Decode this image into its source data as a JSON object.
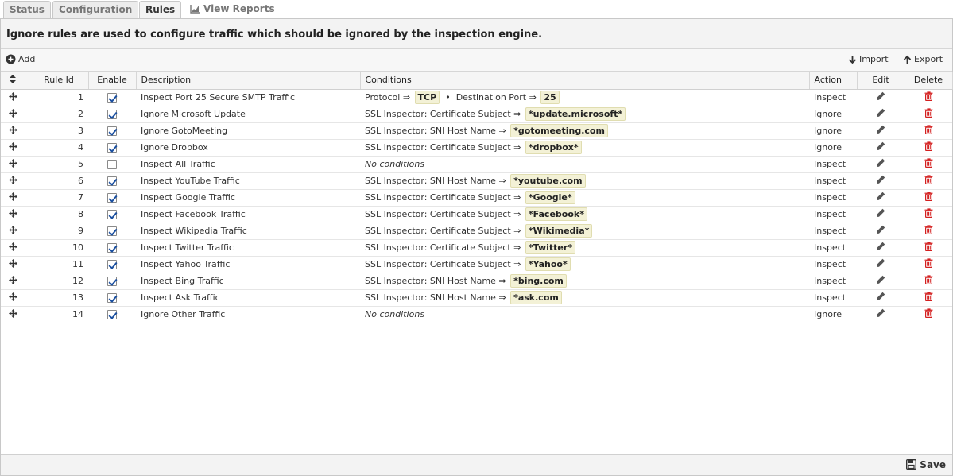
{
  "tabs": [
    {
      "label": "Status"
    },
    {
      "label": "Configuration"
    },
    {
      "label": "Rules"
    },
    {
      "label": "View Reports",
      "icon": "chart-icon"
    }
  ],
  "intro_text": "Ignore rules are used to configure traffic which should be ignored by the inspection engine.",
  "toolbar": {
    "add_label": "Add",
    "import_label": "Import",
    "export_label": "Export"
  },
  "table": {
    "headers": {
      "rule_id": "Rule Id",
      "enable": "Enable",
      "description": "Description",
      "conditions": "Conditions",
      "action": "Action",
      "edit": "Edit",
      "delete": "Delete"
    },
    "rows": [
      {
        "id": "1",
        "enabled": true,
        "description": "Inspect Port 25 Secure SMTP Traffic",
        "conditions": [
          {
            "label": "Protocol ⇒",
            "value": "TCP"
          },
          {
            "label": "Destination Port ⇒",
            "value": "25"
          }
        ],
        "action": "Inspect"
      },
      {
        "id": "2",
        "enabled": true,
        "description": "Ignore Microsoft Update",
        "conditions": [
          {
            "label": "SSL Inspector: Certificate Subject ⇒",
            "value": "*update.microsoft*"
          }
        ],
        "action": "Ignore"
      },
      {
        "id": "3",
        "enabled": true,
        "description": "Ignore GotoMeeting",
        "conditions": [
          {
            "label": "SSL Inspector: SNI Host Name ⇒",
            "value": "*gotomeeting.com"
          }
        ],
        "action": "Ignore"
      },
      {
        "id": "4",
        "enabled": true,
        "description": "Ignore Dropbox",
        "conditions": [
          {
            "label": "SSL Inspector: Certificate Subject ⇒",
            "value": "*dropbox*"
          }
        ],
        "action": "Ignore"
      },
      {
        "id": "5",
        "enabled": false,
        "description": "Inspect All Traffic",
        "no_conditions": "No conditions",
        "conditions": [],
        "action": "Inspect"
      },
      {
        "id": "6",
        "enabled": true,
        "description": "Inspect YouTube Traffic",
        "conditions": [
          {
            "label": "SSL Inspector: SNI Host Name ⇒",
            "value": "*youtube.com"
          }
        ],
        "action": "Inspect"
      },
      {
        "id": "7",
        "enabled": true,
        "description": "Inspect Google Traffic",
        "conditions": [
          {
            "label": "SSL Inspector: Certificate Subject ⇒",
            "value": "*Google*"
          }
        ],
        "action": "Inspect"
      },
      {
        "id": "8",
        "enabled": true,
        "description": "Inspect Facebook Traffic",
        "conditions": [
          {
            "label": "SSL Inspector: Certificate Subject ⇒",
            "value": "*Facebook*"
          }
        ],
        "action": "Inspect"
      },
      {
        "id": "9",
        "enabled": true,
        "description": "Inspect Wikipedia Traffic",
        "conditions": [
          {
            "label": "SSL Inspector: Certificate Subject ⇒",
            "value": "*Wikimedia*"
          }
        ],
        "action": "Inspect"
      },
      {
        "id": "10",
        "enabled": true,
        "description": "Inspect Twitter Traffic",
        "conditions": [
          {
            "label": "SSL Inspector: Certificate Subject ⇒",
            "value": "*Twitter*"
          }
        ],
        "action": "Inspect"
      },
      {
        "id": "11",
        "enabled": true,
        "description": "Inspect Yahoo Traffic",
        "conditions": [
          {
            "label": "SSL Inspector: Certificate Subject ⇒",
            "value": "*Yahoo*"
          }
        ],
        "action": "Inspect"
      },
      {
        "id": "12",
        "enabled": true,
        "description": "Inspect Bing Traffic",
        "conditions": [
          {
            "label": "SSL Inspector: SNI Host Name ⇒",
            "value": "*bing.com"
          }
        ],
        "action": "Inspect"
      },
      {
        "id": "13",
        "enabled": true,
        "description": "Inspect Ask Traffic",
        "conditions": [
          {
            "label": "SSL Inspector: SNI Host Name ⇒",
            "value": "*ask.com"
          }
        ],
        "action": "Inspect"
      },
      {
        "id": "14",
        "enabled": true,
        "description": "Ignore Other Traffic",
        "no_conditions": "No conditions",
        "conditions": [],
        "action": "Ignore"
      }
    ]
  },
  "footer": {
    "save_label": "Save"
  },
  "colors": {
    "delete_icon": "#d42020",
    "tag_background": "#f3f1d6"
  }
}
